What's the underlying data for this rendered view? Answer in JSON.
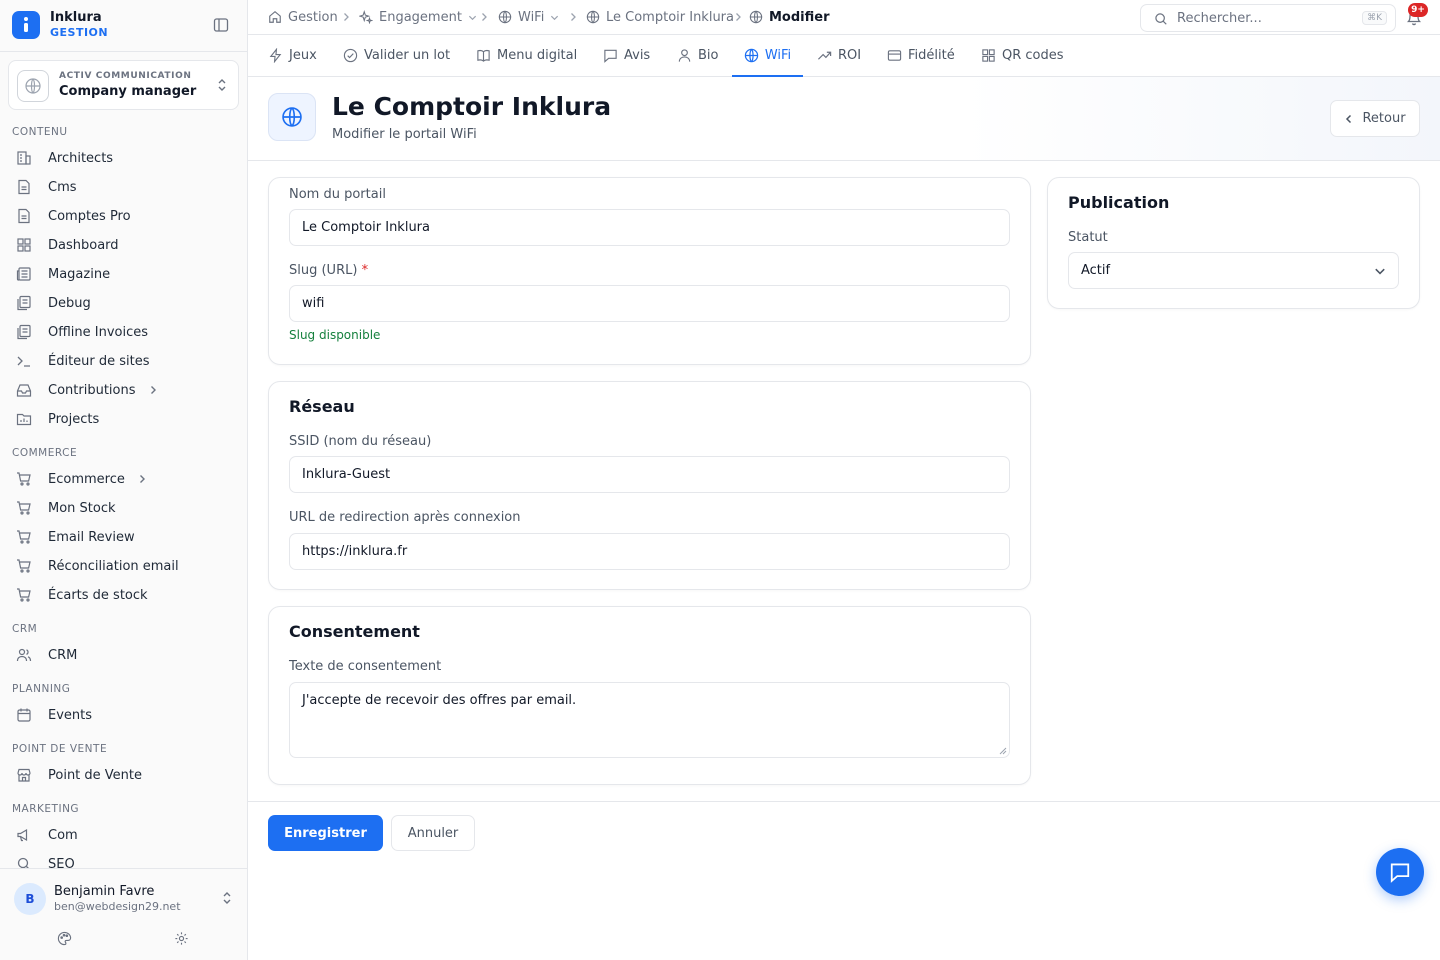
{
  "brand": {
    "name": "Inklura",
    "subtitle": "GESTION"
  },
  "org": {
    "kicker": "ACTIV COMMUNICATION",
    "name": "Company manager"
  },
  "sidebar": {
    "sections": [
      {
        "label": "CONTENU"
      },
      {
        "label": "COMMERCE"
      },
      {
        "label": "CRM"
      },
      {
        "label": "PLANNING"
      },
      {
        "label": "POINT DE VENTE"
      },
      {
        "label": "MARKETING"
      }
    ],
    "items": [
      {
        "label": "Architects",
        "icon": "building-icon"
      },
      {
        "label": "Cms",
        "icon": "document-icon"
      },
      {
        "label": "Comptes Pro",
        "icon": "document-icon"
      },
      {
        "label": "Dashboard",
        "icon": "grid-icon"
      },
      {
        "label": "Magazine",
        "icon": "newspaper-icon"
      },
      {
        "label": "Debug",
        "icon": "files-icon"
      },
      {
        "label": "Offline Invoices",
        "icon": "files-icon"
      },
      {
        "label": "Éditeur de sites",
        "icon": "terminal-icon"
      },
      {
        "label": "Contributions",
        "icon": "inbox-icon"
      },
      {
        "label": "Projects",
        "icon": "folder-icon"
      },
      {
        "label": "Ecommerce",
        "icon": "cart-icon"
      },
      {
        "label": "Mon Stock",
        "icon": "cart-icon"
      },
      {
        "label": "Email Review",
        "icon": "cart-icon"
      },
      {
        "label": "Réconciliation email",
        "icon": "cart-icon"
      },
      {
        "label": "Écarts de stock",
        "icon": "cart-icon"
      },
      {
        "label": "CRM",
        "icon": "users-icon"
      },
      {
        "label": "Events",
        "icon": "calendar-icon"
      },
      {
        "label": "Point de Vente",
        "icon": "store-icon"
      },
      {
        "label": "Com",
        "icon": "megaphone-icon"
      },
      {
        "label": "SEO",
        "icon": "search-icon"
      }
    ]
  },
  "user": {
    "initial": "B",
    "name": "Benjamin Favre",
    "email": "ben@webdesign29.net"
  },
  "breadcrumb": [
    "Gestion",
    "Engagement",
    "WiFi",
    "Le Comptoir Inklura",
    "Modifier"
  ],
  "search": {
    "placeholder": "Rechercher...",
    "shortcut": "⌘K"
  },
  "notifications": {
    "count": "9+"
  },
  "tabs": [
    "Jeux",
    "Valider un lot",
    "Menu digital",
    "Avis",
    "Bio",
    "WiFi",
    "ROI",
    "Fidélité",
    "QR codes"
  ],
  "active_tab": "WiFi",
  "header": {
    "title": "Le Comptoir Inklura",
    "subtitle": "Modifier le portail WiFi",
    "back_label": "Retour"
  },
  "form": {
    "portal_name_label": "Nom du portail",
    "portal_name_value": "Le Comptoir Inklura",
    "slug_label": "Slug (URL)",
    "slug_required": "*",
    "slug_value": "wifi",
    "slug_status": "Slug disponible",
    "network_title": "Réseau",
    "ssid_label": "SSID (nom du réseau)",
    "ssid_value": "Inklura-Guest",
    "redirect_label": "URL de redirection après connexion",
    "redirect_value": "https://inklura.fr",
    "consent_title": "Consentement",
    "consent_label": "Texte de consentement",
    "consent_value": "J'accepte de recevoir des offres par email."
  },
  "publication": {
    "title": "Publication",
    "status_label": "Statut",
    "status_value": "Actif"
  },
  "actions": {
    "save_label": "Enregistrer",
    "cancel_label": "Annuler"
  },
  "colors": {
    "accent": "#1d6ff2",
    "success": "#15803d",
    "danger": "#dc2626"
  }
}
